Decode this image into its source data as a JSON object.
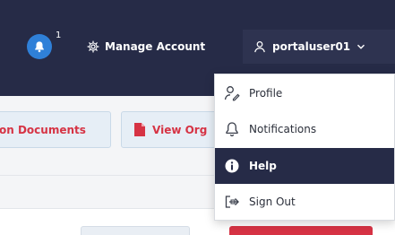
{
  "colors": {
    "nav_bg": "#262b47",
    "accent_blue": "#2f80d8",
    "danger_red": "#d63344"
  },
  "header": {
    "notification_count": "1",
    "manage_account_label": "Manage Account",
    "username": "portaluser01"
  },
  "toolbar": {
    "documents_button_label": "on Documents",
    "view_button_label": "View Org"
  },
  "user_menu": {
    "items": [
      {
        "label": "Profile",
        "icon": "profile-icon"
      },
      {
        "label": "Notifications",
        "icon": "bell-outline-icon"
      },
      {
        "label": "Help",
        "icon": "info-icon",
        "active": true
      },
      {
        "label": "Sign Out",
        "icon": "sign-out-icon"
      }
    ]
  }
}
